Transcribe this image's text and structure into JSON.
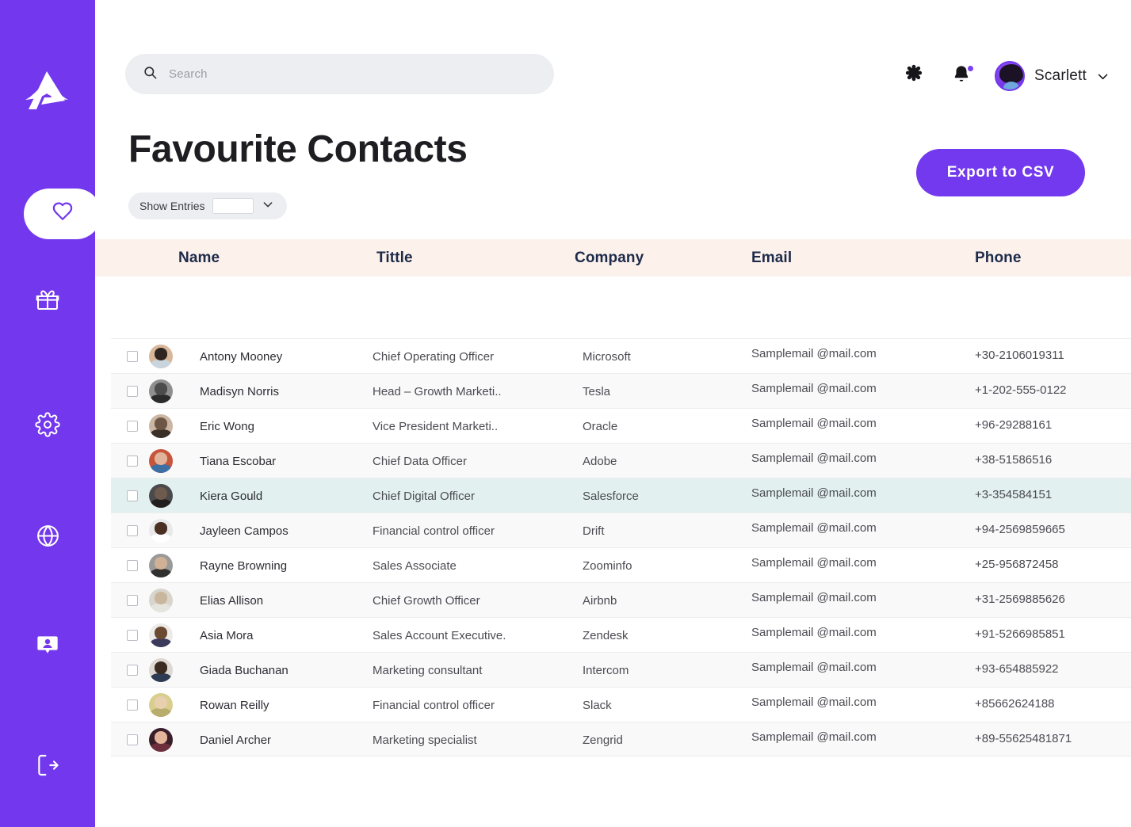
{
  "brand": {
    "logo_name": "triangle-a-logo",
    "sidebar_color": "#7338ee",
    "accent_color": "#7339ee",
    "header_row_color": "#fdf1ec",
    "selected_row_color": "#e2f1ef"
  },
  "sidebar": {
    "items": [
      {
        "icon": "heart-icon",
        "name": "favourites",
        "active": true
      },
      {
        "icon": "gift-icon",
        "name": "rewards",
        "active": false
      },
      {
        "icon": "gear-icon",
        "name": "settings",
        "active": false
      },
      {
        "icon": "globe-icon",
        "name": "network",
        "active": false
      },
      {
        "icon": "contact-card-icon",
        "name": "contacts",
        "active": false
      },
      {
        "icon": "logout-icon",
        "name": "logout",
        "active": false
      }
    ]
  },
  "search": {
    "placeholder": "Search",
    "value": "",
    "icon": "search-icon"
  },
  "header": {
    "settings_icon": "asterisk-gear-icon",
    "notification_icon": "bell-icon",
    "notification_badge": true,
    "user_name": "Scarlett",
    "chevron_icon": "chevron-down-icon",
    "avatar": "user-avatar"
  },
  "page": {
    "title": "Favourite Contacts",
    "export_button": "Export to CSV"
  },
  "controls": {
    "show_entries_label": "Show Entries",
    "show_entries_value": "",
    "chevron_icon": "chevron-down-icon"
  },
  "table": {
    "columns": [
      "Name",
      "Tittle",
      "Company",
      "Email",
      "Phone"
    ],
    "rows": [
      {
        "name": "Antony Mooney",
        "title": "Chief Operating Officer",
        "company": "Microsoft",
        "email": "Samplemail @mail.com",
        "phone": "+30-2106019311",
        "selected": false,
        "avatar_colors": [
          "#d9b79a",
          "#2f2622",
          "#c9d4dd"
        ]
      },
      {
        "name": "Madisyn Norris",
        "title": "Head – Growth Marketi..",
        "company": "Tesla",
        "email": "Samplemail @mail.com",
        "phone": "+1-202-555-0122",
        "selected": false,
        "avatar_colors": [
          "#8f8f8f",
          "#4c4c4c",
          "#2b2b2b"
        ]
      },
      {
        "name": "Eric Wong",
        "title": "Vice President Marketi..",
        "company": "Oracle",
        "email": "Samplemail @mail.com",
        "phone": "+96-29288161",
        "selected": false,
        "avatar_colors": [
          "#cbb6a4",
          "#6d5645",
          "#3b3028"
        ]
      },
      {
        "name": "Tiana Escobar",
        "title": "Chief Data Officer",
        "company": "Adobe",
        "email": "Samplemail @mail.com",
        "phone": "+38-51586516",
        "selected": false,
        "avatar_colors": [
          "#c7553c",
          "#e0b49a",
          "#3d6fa3"
        ]
      },
      {
        "name": "Kiera Gould",
        "title": "Chief Digital Officer",
        "company": "Salesforce",
        "email": "Samplemail @mail.com",
        "phone": "+3-354584151",
        "selected": true,
        "avatar_colors": [
          "#4a4a4c",
          "#6e5b4d",
          "#22201f"
        ]
      },
      {
        "name": "Jayleen Campos",
        "title": "Financial control officer",
        "company": "Drift",
        "email": "Samplemail @mail.com",
        "phone": "+94-2569859665",
        "selected": false,
        "avatar_colors": [
          "#e9e9e9",
          "#4a2f22",
          "#ffffff"
        ]
      },
      {
        "name": "Rayne Browning",
        "title": "Sales Associate",
        "company": "Zoominfo",
        "email": "Samplemail @mail.com",
        "phone": "+25-956872458",
        "selected": false,
        "avatar_colors": [
          "#9a9a9a",
          "#d0b196",
          "#30302f"
        ]
      },
      {
        "name": "Elias Allison",
        "title": "Chief Growth Officer",
        "company": "Airbnb",
        "email": "Samplemail @mail.com",
        "phone": "+31-2569885626",
        "selected": false,
        "avatar_colors": [
          "#d8d5cd",
          "#c8b79c",
          "#e6e4de"
        ]
      },
      {
        "name": "Asia Mora",
        "title": "Sales Account Executive.",
        "company": "Zendesk",
        "email": "Samplemail @mail.com",
        "phone": "+91-5266985851",
        "selected": false,
        "avatar_colors": [
          "#ecebe9",
          "#6b4a31",
          "#3b3a5c"
        ]
      },
      {
        "name": "Giada Buchanan",
        "title": "Marketing consultant",
        "company": "Intercom",
        "email": "Samplemail @mail.com",
        "phone": "+93-654885922",
        "selected": false,
        "avatar_colors": [
          "#ddd9d2",
          "#3a2a20",
          "#2d3c52"
        ]
      },
      {
        "name": "Rowan Reilly",
        "title": "Financial control officer",
        "company": "Slack",
        "email": "Samplemail @mail.com",
        "phone": "+85662624188",
        "selected": false,
        "avatar_colors": [
          "#d8cf8e",
          "#e8cfae",
          "#b8ad6e"
        ]
      },
      {
        "name": "Daniel Archer",
        "title": "Marketing specialist",
        "company": "Zengrid",
        "email": "Samplemail @mail.com",
        "phone": "+89-55625481871",
        "selected": false,
        "avatar_colors": [
          "#3a1f2b",
          "#e4b59a",
          "#6d2f3c"
        ]
      }
    ]
  }
}
